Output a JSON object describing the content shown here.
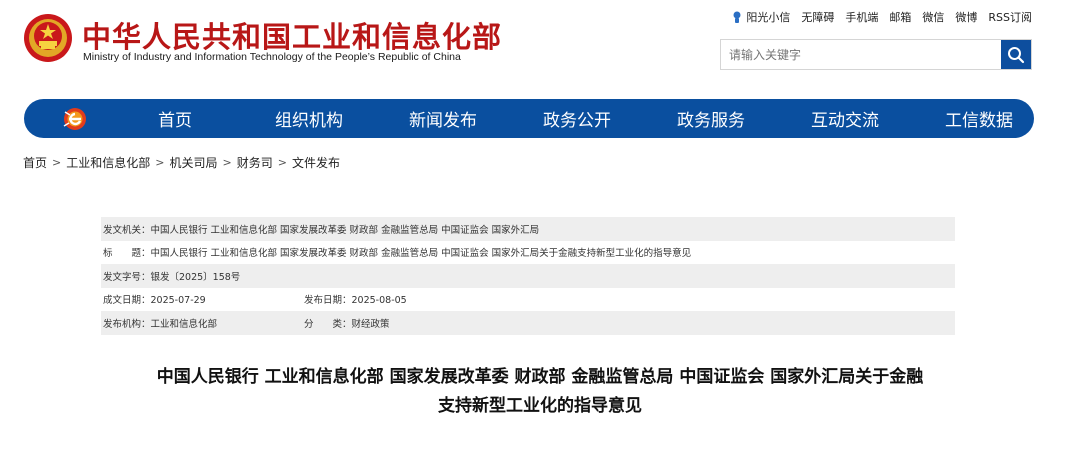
{
  "header": {
    "title": "中华人民共和国工业和信息化部",
    "subtitle": "Ministry of Industry and Information Technology of the People’s Republic of China",
    "emblem_icon": "national-emblem-icon"
  },
  "toplinks": {
    "items": [
      "阳光小信",
      "无障碍",
      "手机端",
      "邮箱",
      "微信",
      "微博",
      "RSS订阅"
    ]
  },
  "search": {
    "placeholder": "请输入关键字"
  },
  "nav": {
    "logo_icon": "e-logo-icon",
    "items": [
      "首页",
      "组织机构",
      "新闻发布",
      "政务公开",
      "政务服务",
      "互动交流",
      "工信数据"
    ]
  },
  "breadcrumb": [
    "首页",
    "工业和信息化部",
    "机关司局",
    "财务司",
    "文件发布"
  ],
  "meta": {
    "issuer": "发文机关：中国人民银行 工业和信息化部 国家发展改革委 财政部 金融监管总局 中国证监会 国家外汇局",
    "title": "标　　题：中国人民银行 工业和信息化部 国家发展改革委 财政部 金融监管总局 中国证监会 国家外汇局关于金融支持新型工业化的指导意见",
    "doc_number": "发文字号：银发〔2025〕158号",
    "written_date": "成文日期：2025-07-29",
    "publish_date": "发布日期：2025-08-05",
    "publisher": "发布机构：工业和信息化部",
    "category": "分　　类：财经政策"
  },
  "document": {
    "title_line1": "中国人民银行 工业和信息化部 国家发展改革委 财政部 金融监管总局 中国证监会 国家外汇局关于金融",
    "title_line2": "支持新型工业化的指导意见"
  },
  "colors": {
    "brand_red": "#b81717",
    "nav_blue": "#0a4f9f",
    "row_shade": "#eeeeee"
  }
}
